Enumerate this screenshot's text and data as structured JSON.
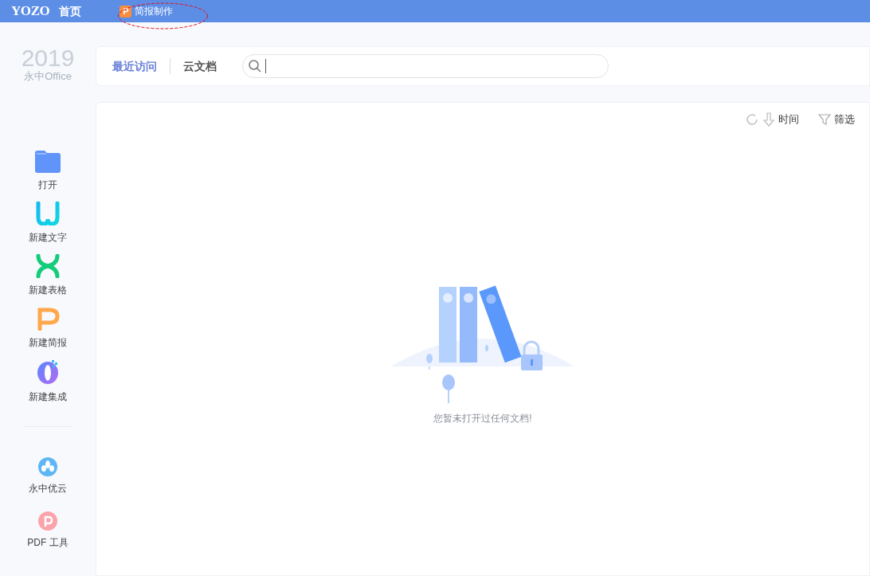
{
  "top_bar": {
    "logo": "YOZO",
    "home": "首页",
    "open_tab": {
      "icon_letter": "P",
      "label": "简报制作",
      "annotated": true
    }
  },
  "brand": {
    "year": "2019",
    "product": "永中Office"
  },
  "tabs": [
    {
      "label": "最近访问",
      "selected": true
    },
    {
      "label": "云文档",
      "selected": false
    }
  ],
  "sidebar": {
    "items": [
      {
        "kind": "folder",
        "label": "打开"
      },
      {
        "kind": "writer",
        "label": "新建文字"
      },
      {
        "kind": "sheet",
        "label": "新建表格"
      },
      {
        "kind": "slides",
        "label": "新建简报"
      },
      {
        "kind": "suite",
        "label": "新建集成"
      }
    ],
    "bottom_items": [
      {
        "kind": "cloud",
        "label": "永中优云"
      },
      {
        "kind": "pdf",
        "label": "PDF 工具"
      }
    ]
  },
  "toolbar": {
    "sort_label": "时间",
    "filter_label": "筛选"
  },
  "empty_state": {
    "message": "您暂未打开过任何文档!"
  }
}
